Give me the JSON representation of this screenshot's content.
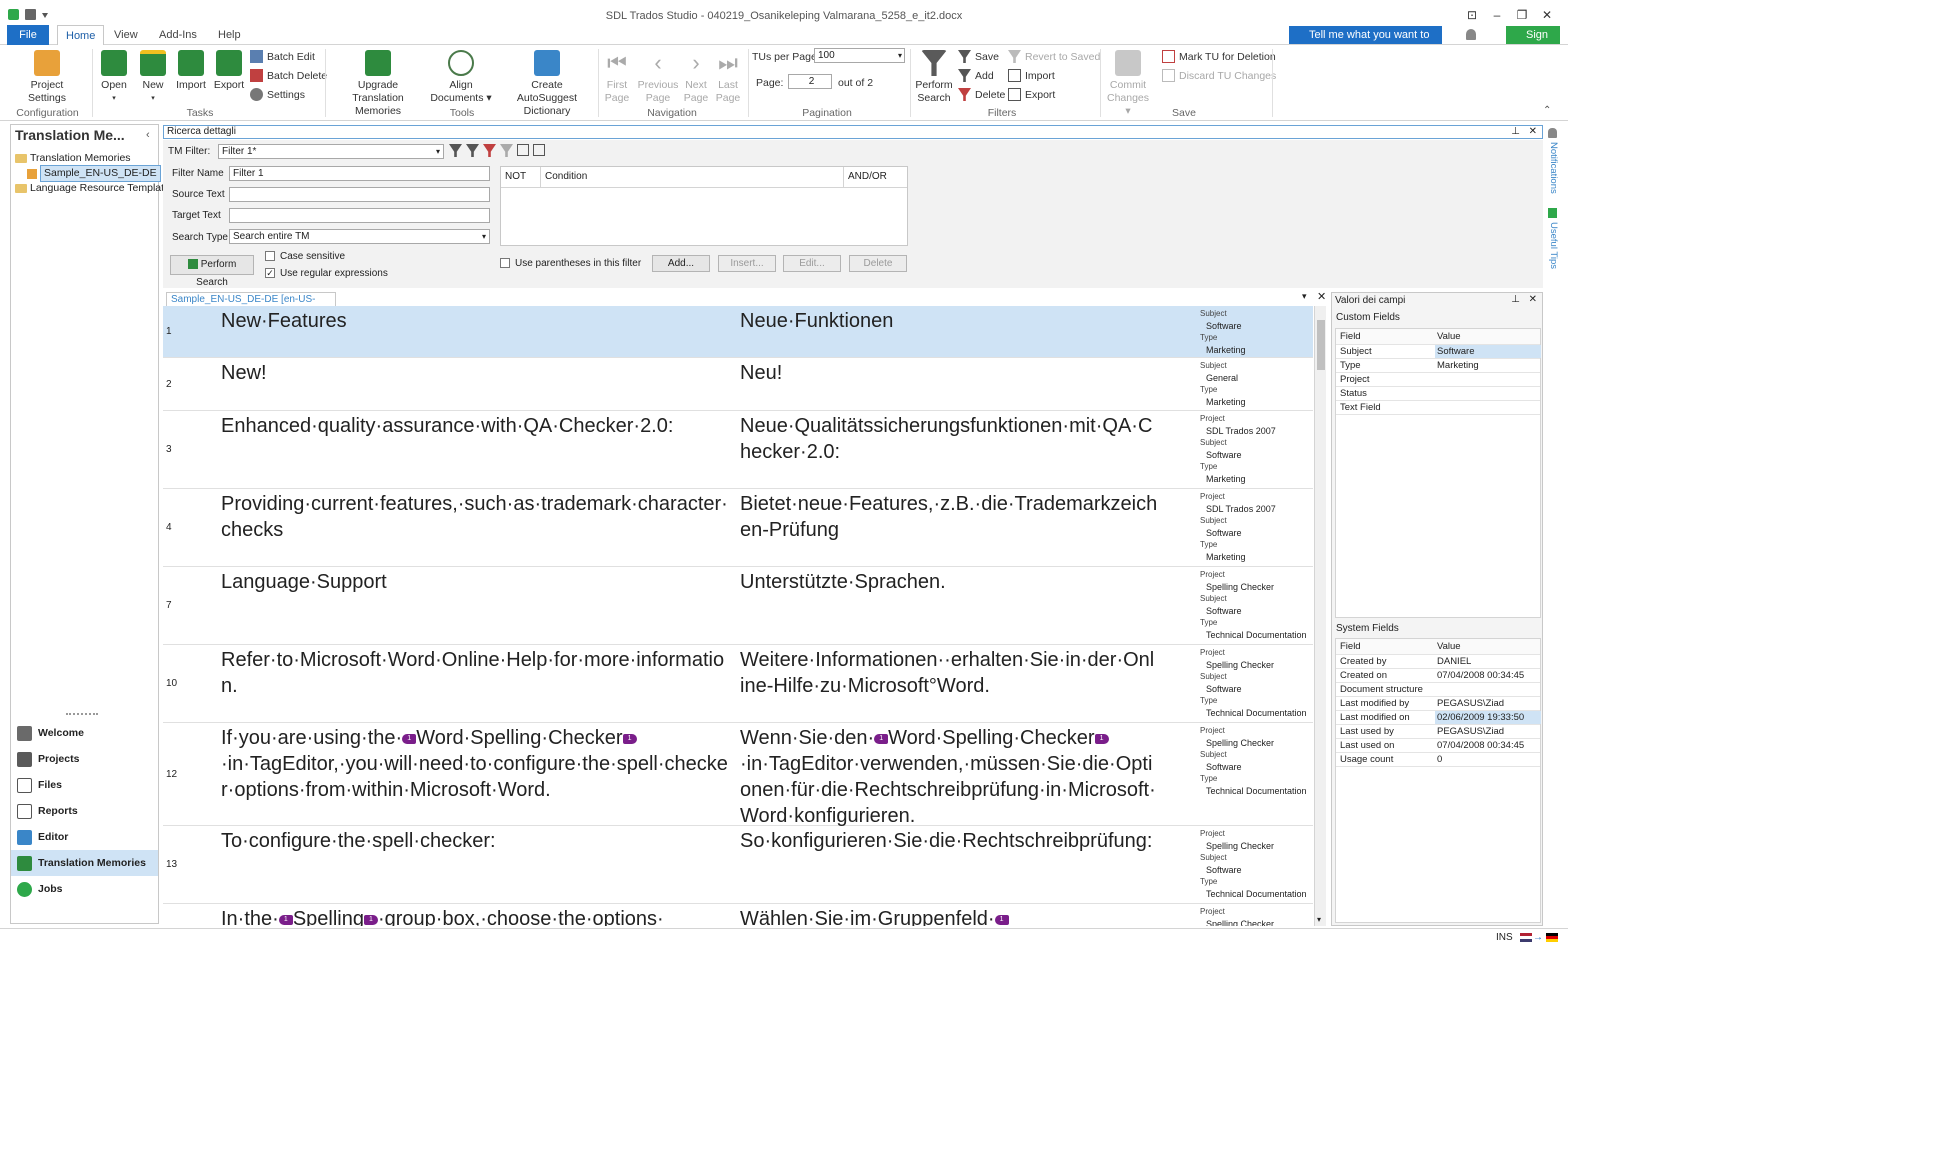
{
  "window": {
    "title": "SDL Trados Studio - 040219_Osanikeleping Valmarana_5258_e_it2.docx"
  },
  "menu": {
    "file": "File",
    "tabs": [
      "Home",
      "View",
      "Add-Ins",
      "Help"
    ],
    "tell_me": "Tell me what you want to do...",
    "sign_in": "Sign In"
  },
  "ribbon": {
    "project_settings": "Project Settings",
    "open": "Open",
    "new": "New",
    "import": "Import",
    "export": "Export",
    "batch_edit": "Batch Edit",
    "batch_delete": "Batch Delete",
    "settings": "Settings",
    "upgrade": "Upgrade Translation Memories",
    "align": "Align Documents",
    "autosuggest": "Create AutoSuggest Dictionary",
    "first_page": "First Page",
    "previous_page": "Previous Page",
    "next_page": "Next Page",
    "last_page": "Last Page",
    "tus_per_page_label": "TUs per Page:",
    "tus_per_page": "100",
    "page_label": "Page:",
    "page": "2",
    "out_of": "out of 2",
    "perform_search": "Perform Search",
    "save": "Save",
    "add": "Add",
    "delete": "Delete",
    "revert": "Revert to Saved",
    "import2": "Import",
    "export2": "Export",
    "commit": "Commit Changes",
    "mark_tu": "Mark TU for Deletion",
    "discard_tu": "Discard TU Changes",
    "groups": {
      "configuration": "Configuration",
      "tasks": "Tasks",
      "tools": "Tools",
      "navigation": "Navigation",
      "pagination": "Pagination",
      "filters": "Filters",
      "save": "Save"
    }
  },
  "left_panel": {
    "title": "Translation Me...",
    "tree": [
      "Translation Memories",
      "Sample_EN-US_DE-DE",
      "Language Resource Templat"
    ],
    "nav": [
      "Welcome",
      "Projects",
      "Files",
      "Reports",
      "Editor",
      "Translation Memories",
      "Jobs"
    ]
  },
  "search": {
    "header": "Ricerca dettagli",
    "tm_filter_label": "TM Filter:",
    "tm_filter": "Filter 1*",
    "filter_name_label": "Filter Name",
    "filter_name": "Filter 1",
    "source_text_label": "Source Text",
    "target_text_label": "Target Text",
    "search_type_label": "Search Type",
    "search_type": "Search entire TM",
    "perform_search": "Perform Search",
    "case_sensitive": "Case sensitive",
    "regex": "Use regular expressions",
    "cond_headers": [
      "NOT",
      "Condition",
      "AND/OR"
    ],
    "parentheses": "Use parentheses in this filter",
    "add": "Add...",
    "insert": "Insert...",
    "edit": "Edit...",
    "delete": "Delete"
  },
  "doc_tab": "Sample_EN-US_DE-DE [en-US->de-DE]",
  "rows": [
    {
      "num": "1",
      "src": "New·Features",
      "tgt": "Neue·Funktionen",
      "fields": [
        [
          "Subject",
          "Software"
        ],
        [
          "Type",
          "Marketing"
        ]
      ]
    },
    {
      "num": "2",
      "src": "New!",
      "tgt": "Neu!",
      "fields": [
        [
          "Subject",
          "General"
        ],
        [
          "Type",
          "Marketing"
        ]
      ]
    },
    {
      "num": "3",
      "src": "Enhanced·quality·assurance·with·QA·Checker·2.0:",
      "tgt": "Neue·Qualitätssicherungsfunktionen·mit·QA·Checker·2.0:",
      "fields": [
        [
          "Project",
          "SDL Trados 2007"
        ],
        [
          "Subject",
          "Software"
        ],
        [
          "Type",
          "Marketing"
        ]
      ]
    },
    {
      "num": "4",
      "src": "Providing·current·features,·such·as·trademark·character·checks",
      "tgt": "Bietet·neue·Features,·z.B.·die·Trademarkzeichen-Prüfung",
      "fields": [
        [
          "Project",
          "SDL Trados 2007"
        ],
        [
          "Subject",
          "Software"
        ],
        [
          "Type",
          "Marketing"
        ]
      ]
    },
    {
      "num": "7",
      "src": "Language·Support",
      "tgt": "Unterstützte·Sprachen.",
      "fields": [
        [
          "Project",
          "Spelling Checker"
        ],
        [
          "Subject",
          "Software"
        ],
        [
          "Type",
          "Technical Documentation"
        ]
      ]
    },
    {
      "num": "10",
      "src": "Refer·to·Microsoft·Word·Online·Help·for·more·information.",
      "tgt": "Weitere·Informationen··erhalten·Sie·in·der·Online-Hilfe·zu·Microsoft°Word.",
      "fields": [
        [
          "Project",
          "Spelling Checker"
        ],
        [
          "Subject",
          "Software"
        ],
        [
          "Type",
          "Technical Documentation"
        ]
      ]
    },
    {
      "num": "12",
      "src_a": "If·you·are·using·the·",
      "src_b": "Word·Spelling·Checker",
      "src_c": "·in·TagEditor,·you·will·need·to·configure·the·spell·checker·options·from·within·Microsoft·Word.",
      "tgt_a": "Wenn·Sie·den·",
      "tgt_b": "Word·Spelling·Checker",
      "tgt_c": "·in·TagEditor·verwenden,·müssen·Sie·die·Optionen·für·die·Rechtschreibprüfung·in·Microsoft·Word·konfigurieren.",
      "fields": [
        [
          "Project",
          "Spelling Checker"
        ],
        [
          "Subject",
          "Software"
        ],
        [
          "Type",
          "Technical Documentation"
        ]
      ]
    },
    {
      "num": "13",
      "src": "To·configure·the·spell·checker:",
      "tgt": "So·konfigurieren·Sie·die·Rechtschreibprüfung:",
      "fields": [
        [
          "Project",
          "Spelling Checker"
        ],
        [
          "Subject",
          "Software"
        ],
        [
          "Type",
          "Technical Documentation"
        ]
      ]
    },
    {
      "num": "",
      "src_a": "In·the·",
      "src_b": "Spelling",
      "src_c": "·group·box,·choose·the·options·",
      "tgt_a": "Wählen·Sie·im·Gruppenfeld·",
      "tgt_b": "",
      "tgt_c": "",
      "fields": [
        [
          "Project",
          "Spelling Checker"
        ]
      ]
    }
  ],
  "tag_label": "1",
  "right_panel": {
    "title": "Valori dei campi",
    "custom_title": "Custom Fields",
    "custom_head": [
      "Field",
      "Value"
    ],
    "custom": [
      [
        "Subject",
        "Software"
      ],
      [
        "Type",
        "Marketing"
      ],
      [
        "Project",
        ""
      ],
      [
        "Status",
        ""
      ],
      [
        "Text Field",
        ""
      ]
    ],
    "system_title": "System Fields",
    "system_head": [
      "Field",
      "Value"
    ],
    "system": [
      [
        "Created by",
        "DANIEL"
      ],
      [
        "Created on",
        "07/04/2008 00:34:45"
      ],
      [
        "Document structure",
        ""
      ],
      [
        "Last modified by",
        "PEGASUS\\Ziad"
      ],
      [
        "Last modified on",
        "02/06/2009 19:33:50"
      ],
      [
        "Last used by",
        "PEGASUS\\Ziad"
      ],
      [
        "Last used on",
        "07/04/2008 00:34:45"
      ],
      [
        "Usage count",
        "0"
      ]
    ]
  },
  "side_tabs": [
    "Notifications",
    "Useful Tips"
  ],
  "status": {
    "mode": "INS"
  }
}
